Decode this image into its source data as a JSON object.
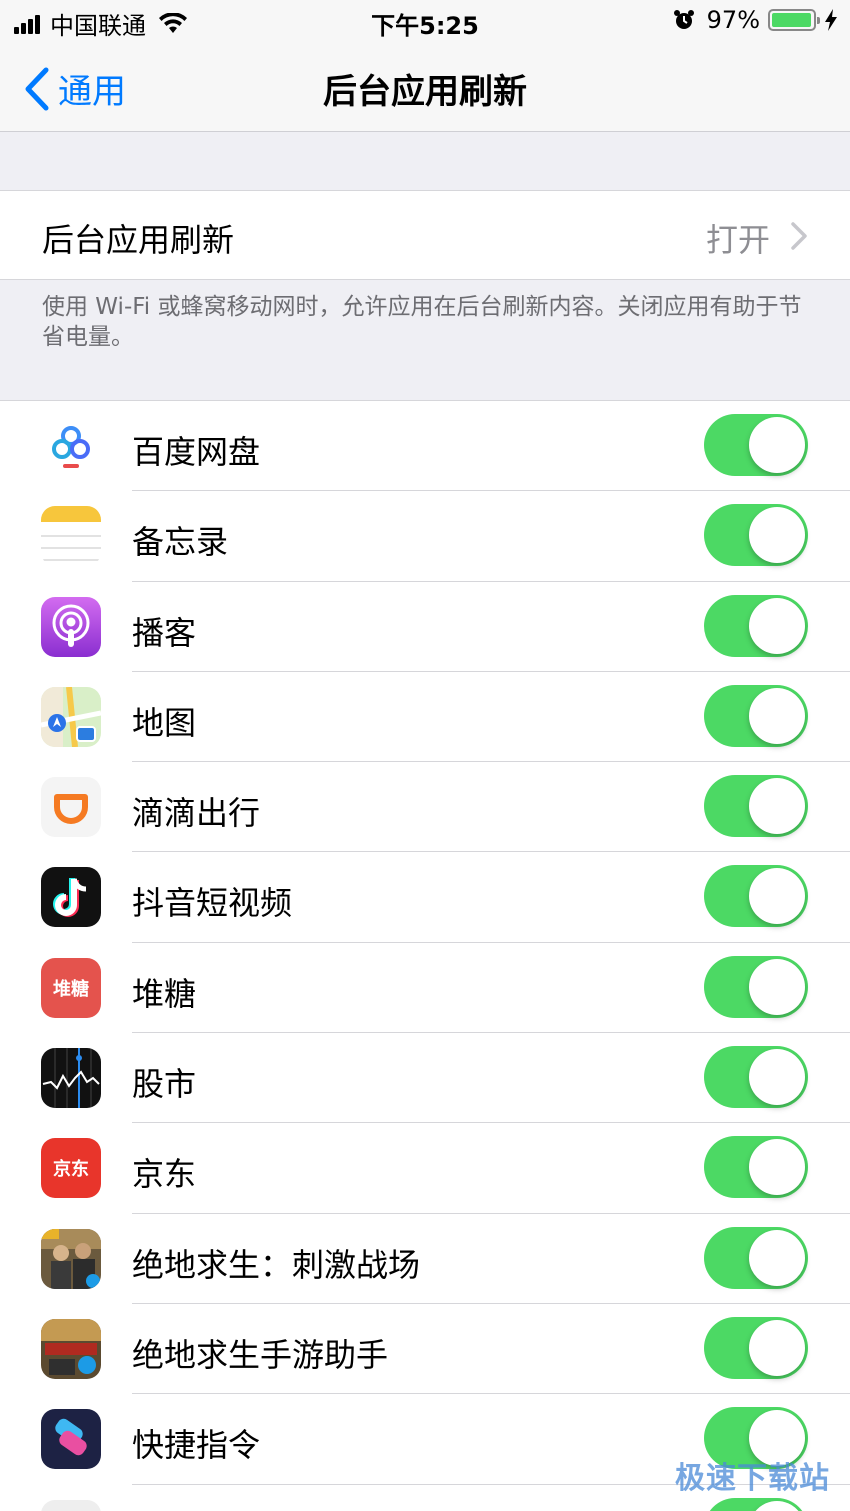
{
  "status_bar": {
    "carrier": "中国联通",
    "time": "下午5:25",
    "battery_percent": "97%",
    "battery_level": 0.97,
    "icons": [
      "signal-icon",
      "wifi-icon",
      "alarm-icon",
      "battery-icon",
      "charging-bolt-icon"
    ]
  },
  "nav": {
    "back_label": "通用",
    "title": "后台应用刷新"
  },
  "setting": {
    "label": "后台应用刷新",
    "value": "打开"
  },
  "footer_note": "使用 Wi-Fi 或蜂窝移动网时，允许应用在后台刷新内容。关闭应用有助于节省电量。",
  "apps": [
    {
      "name": "百度网盘",
      "icon": "baidu-netdisk-icon",
      "enabled": true
    },
    {
      "name": "备忘录",
      "icon": "notes-icon",
      "enabled": true
    },
    {
      "name": "播客",
      "icon": "podcasts-icon",
      "enabled": true
    },
    {
      "name": "地图",
      "icon": "maps-icon",
      "enabled": true
    },
    {
      "name": "滴滴出行",
      "icon": "didi-icon",
      "enabled": true
    },
    {
      "name": "抖音短视频",
      "icon": "douyin-icon",
      "enabled": true
    },
    {
      "name": "堆糖",
      "icon": "duitang-icon",
      "icon_text": "堆糖",
      "enabled": true
    },
    {
      "name": "股市",
      "icon": "stocks-icon",
      "enabled": true
    },
    {
      "name": "京东",
      "icon": "jd-icon",
      "icon_text": "京东",
      "enabled": true
    },
    {
      "name": "绝地求生：刺激战场",
      "icon": "pubg-icon",
      "enabled": true
    },
    {
      "name": "绝地求生手游助手",
      "icon": "pubg-helper-icon",
      "enabled": true
    },
    {
      "name": "快捷指令",
      "icon": "shortcuts-icon",
      "enabled": true
    },
    {
      "name": "",
      "icon": "app-icon",
      "enabled": true
    }
  ],
  "watermark": "极速下载站",
  "colors": {
    "accent": "#007aff",
    "toggle_on": "#4cd964",
    "background": "#efeff4"
  }
}
